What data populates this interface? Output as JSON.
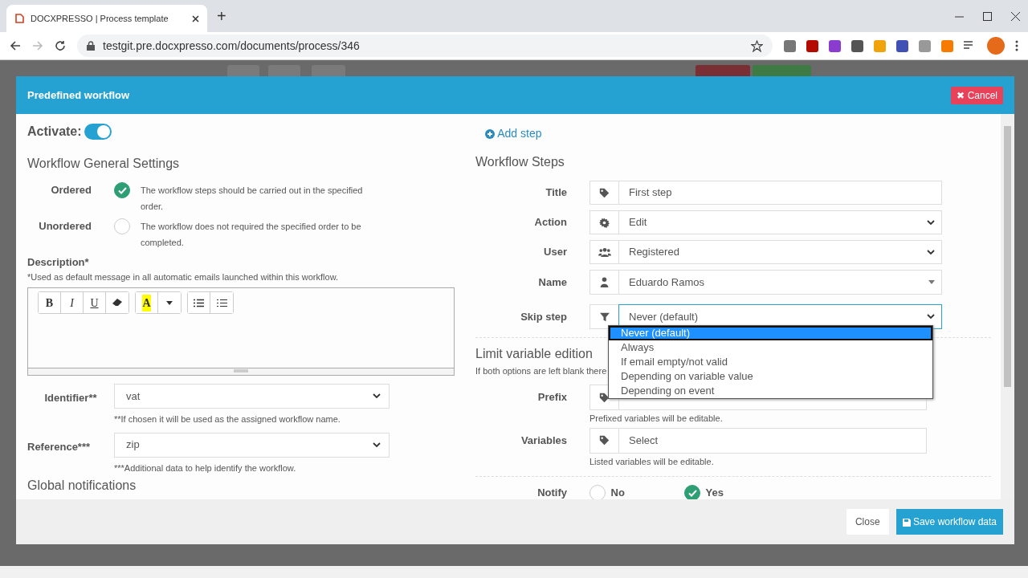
{
  "browser": {
    "tab_title": "DOCXPRESSO | Process template",
    "new_tab": "+",
    "url": "testgit.pre.docxpresso.com/documents/process/346"
  },
  "modal": {
    "title": "Predefined workflow",
    "cancel": "✖ Cancel"
  },
  "activate": {
    "label": "Activate:",
    "on": true
  },
  "general": {
    "heading": "Workflow General Settings",
    "order_options": [
      {
        "label": "Ordered",
        "description": "The workflow steps should be carried out in the specified order.",
        "selected": true
      },
      {
        "label": "Unordered",
        "description": "The workflow does not required the specified order to be completed.",
        "selected": false
      }
    ],
    "description": {
      "label": "Description*",
      "hint": "*Used as default message in all automatic emails launched within this workflow.",
      "toolbar": [
        [
          "B",
          "I",
          "U"
        ],
        [
          "A"
        ]
      ]
    },
    "identifier": {
      "label": "Identifier**",
      "value": "vat",
      "hint": "**If chosen it will be used as the assigned workflow name."
    },
    "reference": {
      "label": "Reference***",
      "value": "zip",
      "hint": "***Additional data to help identify the workflow."
    },
    "global_heading": "Global notifications"
  },
  "steps": {
    "add_step": "Add step",
    "heading": "Workflow Steps",
    "fields": [
      {
        "label": "Title",
        "kind": "input",
        "value": "First step"
      },
      {
        "label": "Action",
        "kind": "select",
        "value": "Edit"
      },
      {
        "label": "User",
        "kind": "select",
        "value": "Registered"
      },
      {
        "label": "Name",
        "kind": "combo",
        "value": "Eduardo Ramos"
      },
      {
        "label": "Skip step",
        "kind": "select",
        "value": "Never (default)",
        "expanded": true
      }
    ],
    "skip_options": [
      {
        "label": "Never (default)",
        "selected": true
      },
      {
        "label": "Always",
        "selected": false
      },
      {
        "label": "If email empty/not valid",
        "selected": false
      },
      {
        "label": "Depending on variable value",
        "selected": false
      },
      {
        "label": "Depending on event",
        "selected": false
      }
    ],
    "limit_heading": "Limit variable edition",
    "limit_hint": "If both options are left blank there",
    "prefix": {
      "label": "Prefix",
      "hint": "Prefixed variables will be editable."
    },
    "variables": {
      "label": "Variables",
      "value": "Select",
      "hint": "Listed variables will be editable."
    },
    "notify": {
      "label": "Notify",
      "options": [
        {
          "label": "No",
          "selected": false
        },
        {
          "label": "Yes",
          "selected": true
        }
      ]
    }
  },
  "footer": {
    "close": "Close",
    "save": "Save workflow data"
  }
}
